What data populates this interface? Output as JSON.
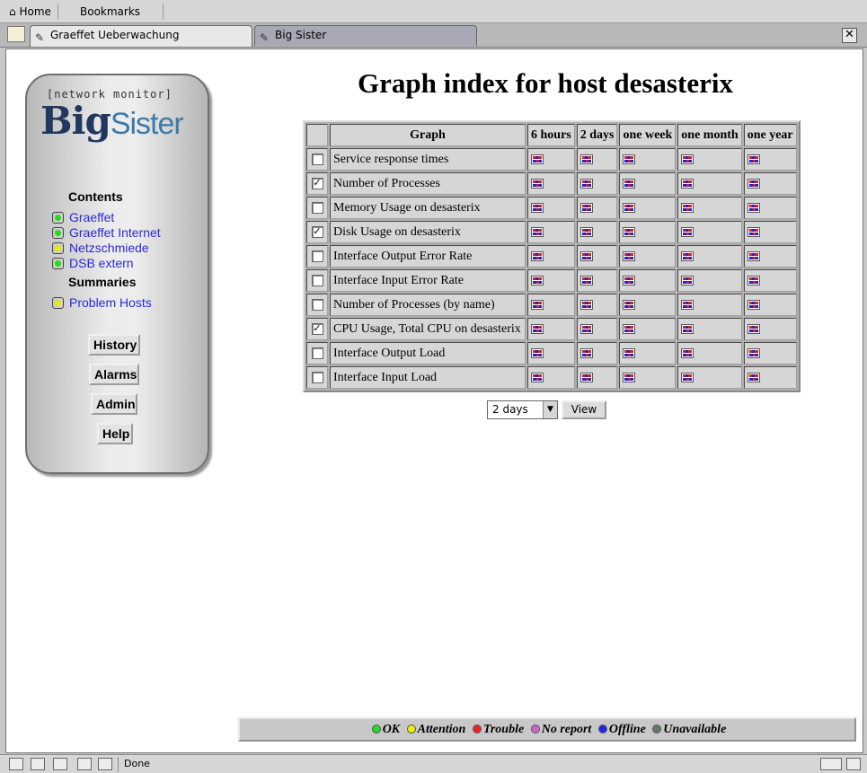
{
  "toolbar": {
    "home_label": "Home",
    "bookmarks_label": "Bookmarks"
  },
  "tabs": [
    {
      "label": "Graeffet Ueberwachung",
      "active": true
    },
    {
      "label": "Big Sister",
      "active": false
    }
  ],
  "sidebar": {
    "tagline": "[network monitor]",
    "logo_big": "Big",
    "logo_sister": "Sister",
    "contents_heading": "Contents",
    "contents_links": [
      {
        "label": "Graeffet",
        "status_color": "#22dd22"
      },
      {
        "label": "Graeffet Internet",
        "status_color": "#22dd22"
      },
      {
        "label": "Netzschmiede",
        "status_color": "#e8e800"
      },
      {
        "label": "DSB extern",
        "status_color": "#22dd22"
      }
    ],
    "summaries_heading": "Summaries",
    "summaries_links": [
      {
        "label": "Problem Hosts",
        "status_color": "#e8e800"
      }
    ],
    "buttons": [
      "History",
      "Alarms",
      "Admin",
      "Help"
    ]
  },
  "main": {
    "title": "Graph index for host desasterix",
    "table": {
      "headers": [
        "Graph",
        "6 hours",
        "2 days",
        "one week",
        "one month",
        "one year"
      ],
      "rows": [
        {
          "label": "Service response times",
          "checked": false
        },
        {
          "label": "Number of Processes",
          "checked": true
        },
        {
          "label": "Memory Usage on desasterix",
          "checked": false
        },
        {
          "label": "Disk Usage on desasterix",
          "checked": true
        },
        {
          "label": "Interface Output Error Rate",
          "checked": false
        },
        {
          "label": "Interface Input Error Rate",
          "checked": false
        },
        {
          "label": "Number of Processes (by name)",
          "checked": false
        },
        {
          "label": "CPU Usage, Total CPU on desasterix",
          "checked": true
        },
        {
          "label": "Interface Output Load",
          "checked": false
        },
        {
          "label": "Interface Input Load",
          "checked": false
        }
      ]
    },
    "period_select_value": "2 days",
    "view_button_label": "View"
  },
  "legend": [
    {
      "label": "OK",
      "color": "#22dd22"
    },
    {
      "label": "Attention",
      "color": "#eeee00"
    },
    {
      "label": "Trouble",
      "color": "#ee2222"
    },
    {
      "label": "No report",
      "color": "#cc66cc"
    },
    {
      "label": "Offline",
      "color": "#2222ee"
    },
    {
      "label": "Unavailable",
      "color": "#667766"
    }
  ],
  "statusbar": {
    "text": "Done"
  },
  "icons": {
    "check_mark": "✓",
    "close": "✕",
    "select_arrow": "▼",
    "home": "⌂",
    "tab": "✎"
  }
}
